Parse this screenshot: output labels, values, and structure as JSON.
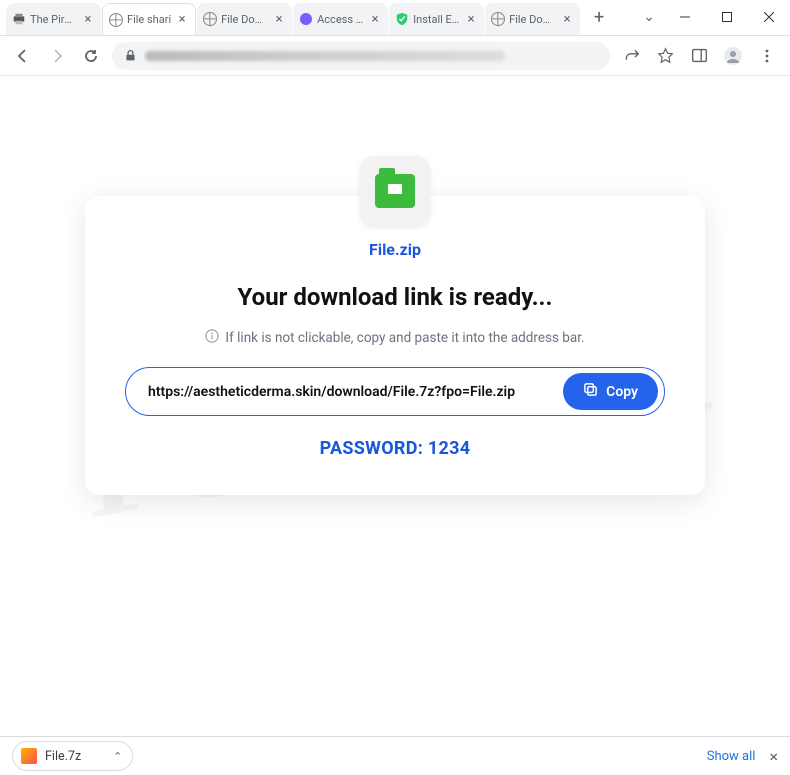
{
  "tabs": [
    {
      "title": "The Pirate",
      "favicon": "printer"
    },
    {
      "title": "File shari",
      "favicon": "globe",
      "active": true
    },
    {
      "title": "File Down",
      "favicon": "globe"
    },
    {
      "title": "Access po",
      "favicon": "dot-purple"
    },
    {
      "title": "Install Ext",
      "favicon": "shield-green"
    },
    {
      "title": "File Down",
      "favicon": "globe"
    }
  ],
  "content": {
    "file_name": "File.zip",
    "heading": "Your download link is ready...",
    "hint": "If link is not clickable, copy and paste it into the address bar.",
    "link": "https://aestheticderma.skin/download/File.7z?fpo=File.zip",
    "copy_label": "Copy",
    "password_line": "PASSWORD: 1234"
  },
  "download_shelf": {
    "item_name": "File.7z",
    "show_all_label": "Show all"
  }
}
